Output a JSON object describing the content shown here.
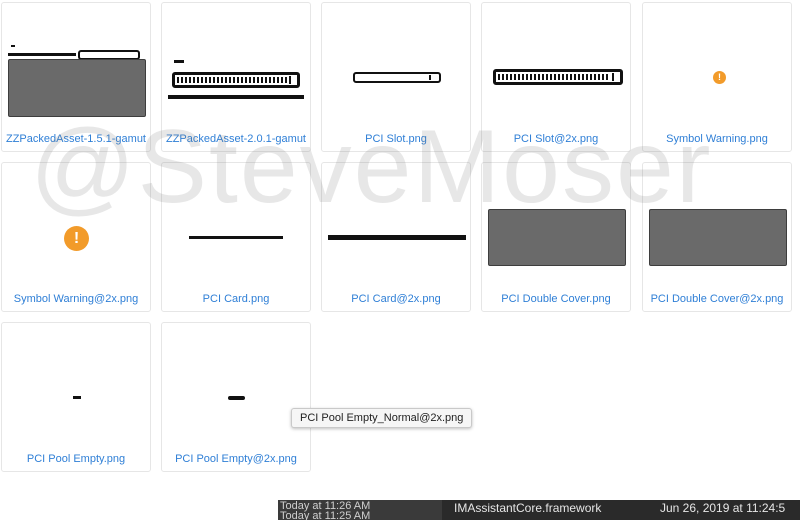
{
  "files": [
    {
      "name": "ZZPackedAsset-1.5.1-gamut"
    },
    {
      "name": "ZZPackedAsset-2.0.1-gamut"
    },
    {
      "name": "PCI Slot.png"
    },
    {
      "name": "PCI Slot@2x.png"
    },
    {
      "name": "Symbol Warning.png"
    },
    {
      "name": "Symbol Warning@2x.png"
    },
    {
      "name": "PCI Card.png"
    },
    {
      "name": "PCI Card@2x.png"
    },
    {
      "name": "PCI Double Cover.png"
    },
    {
      "name": "PCI Double Cover@2x.png"
    },
    {
      "name": "PCI Pool Empty.png"
    },
    {
      "name": "PCI Pool Empty@2x.png"
    }
  ],
  "tooltip": "PCI Pool Empty_Normal@2x.png",
  "watermark": "@SteveMoser",
  "warning_glyph": "!",
  "bottom": {
    "time_line1": "Today at 11:26 AM",
    "time_line2": "Today at 11:25 AM",
    "framework": "IMAssistantCore.framework",
    "date": "Jun 26, 2019 at 11:24:5"
  },
  "colors": {
    "warning": "#f29b2a",
    "filename": "#2f7fd6",
    "cover_gray": "#6a6a6a"
  }
}
